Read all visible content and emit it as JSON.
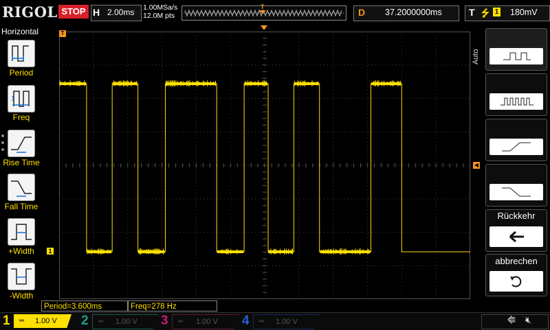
{
  "topbar": {
    "logo": "RIGOL",
    "run_state": "STOP",
    "horizontal_label": "H",
    "timebase": "2.00ms",
    "sample_rate": "1.00MSa/s",
    "memory_depth": "12.0M pts",
    "trigger_marker": "T",
    "delay_label": "D",
    "delay_value": "37.2000000ms",
    "trigger_label": "T",
    "trigger_source": "1",
    "trigger_level": "180mV"
  },
  "left_menu": {
    "title": "Horizontal",
    "items": [
      {
        "label": "Period",
        "icon": "period-measure-icon"
      },
      {
        "label": "Freq",
        "icon": "frequency-measure-icon"
      },
      {
        "label": "Rise Time",
        "icon": "rise-time-icon"
      },
      {
        "label": "Fall Time",
        "icon": "fall-time-icon"
      },
      {
        "label": "+Width",
        "icon": "positive-width-icon"
      },
      {
        "label": "-Width",
        "icon": "negative-width-icon"
      }
    ]
  },
  "screen": {
    "trigger_position_marker": "T",
    "channel_ground_marker": "1",
    "trigger_level_marker": "◀"
  },
  "right_menu": {
    "mode_label": "Auto",
    "items": [
      {
        "icon": "single-pulse-icon"
      },
      {
        "icon": "pulse-train-icon"
      },
      {
        "icon": "rising-edge-icon"
      },
      {
        "icon": "falling-edge-icon"
      }
    ],
    "back_label": "Rückkehr",
    "back_icon": "left-arrow-icon",
    "cancel_label": "abbrechen",
    "cancel_icon": "undo-icon"
  },
  "measurements": {
    "period": "Period=3.600ms",
    "freq": "Freq=278 Hz"
  },
  "channels": [
    {
      "num": "1",
      "scale": "1.00 V",
      "color": "#ffe000",
      "active": true
    },
    {
      "num": "2",
      "scale": "1.00 V",
      "color": "#1a9c8c",
      "active": false
    },
    {
      "num": "3",
      "scale": "1.00 V",
      "color": "#c2187b",
      "active": false
    },
    {
      "num": "4",
      "scale": "1.00 V",
      "color": "#2a5fd1",
      "active": false
    }
  ],
  "status_icons": [
    "usb-icon",
    "mute-icon"
  ],
  "waveform": {
    "type": "square",
    "transitions_divisions": [
      0.0,
      0.8,
      1.55,
      2.3,
      3.1,
      4.6,
      5.4,
      6.1,
      6.85,
      7.6,
      9.1,
      10.0
    ],
    "start_level": "high"
  }
}
